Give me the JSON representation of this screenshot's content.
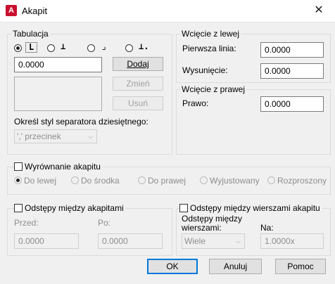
{
  "window": {
    "title": "Akapit",
    "close_glyph": "✕",
    "icon_letter": "A"
  },
  "tabs_group": {
    "legend": "Tabulacja",
    "tab_types": [
      "left-tab-icon",
      "center-tab-icon",
      "right-tab-icon",
      "decimal-tab-icon"
    ],
    "tab_glyphs": [
      "L",
      "⊥",
      "⌟",
      "⊥."
    ],
    "tab_value": "0.0000",
    "add_label": "Dodaj",
    "modify_label": "Zmień",
    "remove_label": "Usuń",
    "separator_label": "Określ styl separatora dziesiętnego:",
    "separator_value": "',' przecinek"
  },
  "indent_left": {
    "legend": "Wcięcie z lewej",
    "first_line_label": "Pierwsza linia:",
    "first_line_value": "0.0000",
    "hanging_label": "Wysunięcie:",
    "hanging_value": "0.0000"
  },
  "indent_right": {
    "legend": "Wcięcie z prawej",
    "right_label": "Prawo:",
    "right_value": "0.0000"
  },
  "alignment": {
    "label": "Wyrównanie akapitu",
    "options": [
      "Do lewej",
      "Do środka",
      "Do prawej",
      "Wyjustowany",
      "Rozproszony"
    ]
  },
  "paragraph_spacing": {
    "label": "Odstępy między akapitami",
    "before_label": "Przed:",
    "before_value": "0.0000",
    "after_label": "Po:",
    "after_value": "0.0000"
  },
  "line_spacing": {
    "label": "Odstępy między wierszami akapitu",
    "spacing_label_1": "Odstępy między",
    "spacing_label_2": "wierszami:",
    "spacing_value": "Wiele",
    "at_label": "Na:",
    "at_value": "1.0000x"
  },
  "buttons": {
    "ok": "OK",
    "cancel": "Anuluj",
    "help": "Pomoc"
  },
  "colors": {
    "accent": "#0078d7",
    "app_icon": "#c8102e"
  }
}
